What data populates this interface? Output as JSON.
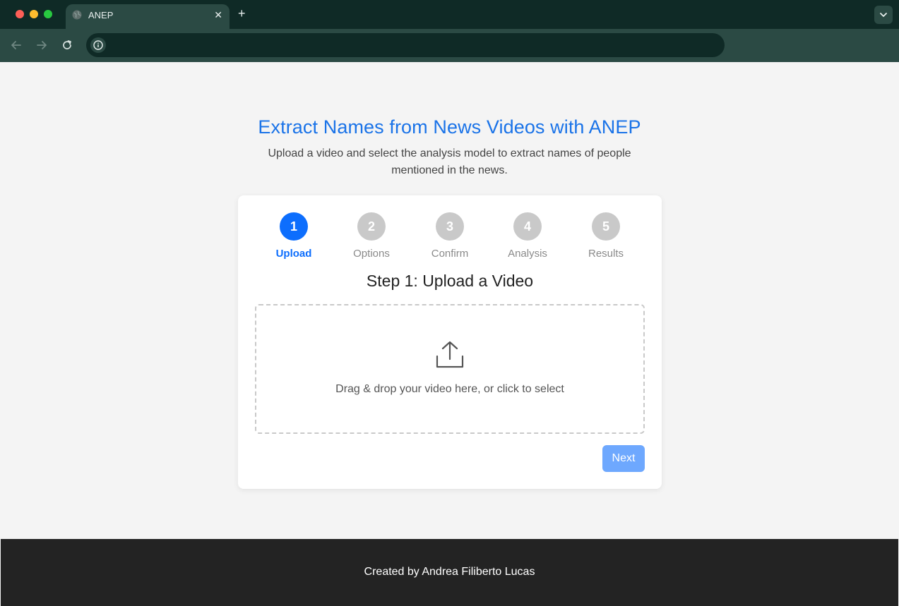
{
  "browser": {
    "tab_title": "ANEP",
    "tab_close": "✕",
    "new_tab": "+"
  },
  "header": {
    "title": "Extract Names from News Videos with ANEP",
    "subtitle": "Upload a video and select the analysis model to extract names of people mentioned in the news."
  },
  "stepper": {
    "active_step": 1,
    "steps": [
      {
        "number": "1",
        "label": "Upload"
      },
      {
        "number": "2",
        "label": "Options"
      },
      {
        "number": "3",
        "label": "Confirm"
      },
      {
        "number": "4",
        "label": "Analysis"
      },
      {
        "number": "5",
        "label": "Results"
      }
    ]
  },
  "upload": {
    "heading": "Step 1: Upload a Video",
    "dropzone_text": "Drag & drop your video here, or click to select",
    "icon": "upload-icon",
    "next_label": "Next"
  },
  "footer": {
    "text": "Created by Andrea Filiberto Lucas"
  },
  "colors": {
    "accent": "#0d6efd",
    "title": "#1a73e8",
    "next_disabled": "#6ea8fe",
    "footer_bg": "#232323"
  }
}
